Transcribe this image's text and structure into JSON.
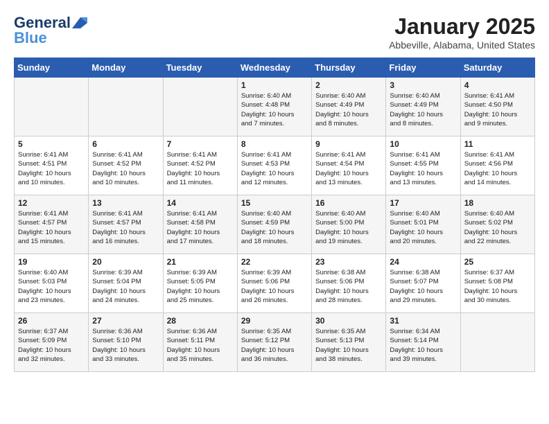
{
  "header": {
    "logo_line1": "General",
    "logo_line2": "Blue",
    "month": "January 2025",
    "location": "Abbeville, Alabama, United States"
  },
  "weekdays": [
    "Sunday",
    "Monday",
    "Tuesday",
    "Wednesday",
    "Thursday",
    "Friday",
    "Saturday"
  ],
  "weeks": [
    [
      {
        "day": "",
        "info": ""
      },
      {
        "day": "",
        "info": ""
      },
      {
        "day": "",
        "info": ""
      },
      {
        "day": "1",
        "info": "Sunrise: 6:40 AM\nSunset: 4:48 PM\nDaylight: 10 hours\nand 7 minutes."
      },
      {
        "day": "2",
        "info": "Sunrise: 6:40 AM\nSunset: 4:49 PM\nDaylight: 10 hours\nand 8 minutes."
      },
      {
        "day": "3",
        "info": "Sunrise: 6:40 AM\nSunset: 4:49 PM\nDaylight: 10 hours\nand 8 minutes."
      },
      {
        "day": "4",
        "info": "Sunrise: 6:41 AM\nSunset: 4:50 PM\nDaylight: 10 hours\nand 9 minutes."
      }
    ],
    [
      {
        "day": "5",
        "info": "Sunrise: 6:41 AM\nSunset: 4:51 PM\nDaylight: 10 hours\nand 10 minutes."
      },
      {
        "day": "6",
        "info": "Sunrise: 6:41 AM\nSunset: 4:52 PM\nDaylight: 10 hours\nand 10 minutes."
      },
      {
        "day": "7",
        "info": "Sunrise: 6:41 AM\nSunset: 4:52 PM\nDaylight: 10 hours\nand 11 minutes."
      },
      {
        "day": "8",
        "info": "Sunrise: 6:41 AM\nSunset: 4:53 PM\nDaylight: 10 hours\nand 12 minutes."
      },
      {
        "day": "9",
        "info": "Sunrise: 6:41 AM\nSunset: 4:54 PM\nDaylight: 10 hours\nand 13 minutes."
      },
      {
        "day": "10",
        "info": "Sunrise: 6:41 AM\nSunset: 4:55 PM\nDaylight: 10 hours\nand 13 minutes."
      },
      {
        "day": "11",
        "info": "Sunrise: 6:41 AM\nSunset: 4:56 PM\nDaylight: 10 hours\nand 14 minutes."
      }
    ],
    [
      {
        "day": "12",
        "info": "Sunrise: 6:41 AM\nSunset: 4:57 PM\nDaylight: 10 hours\nand 15 minutes."
      },
      {
        "day": "13",
        "info": "Sunrise: 6:41 AM\nSunset: 4:57 PM\nDaylight: 10 hours\nand 16 minutes."
      },
      {
        "day": "14",
        "info": "Sunrise: 6:41 AM\nSunset: 4:58 PM\nDaylight: 10 hours\nand 17 minutes."
      },
      {
        "day": "15",
        "info": "Sunrise: 6:40 AM\nSunset: 4:59 PM\nDaylight: 10 hours\nand 18 minutes."
      },
      {
        "day": "16",
        "info": "Sunrise: 6:40 AM\nSunset: 5:00 PM\nDaylight: 10 hours\nand 19 minutes."
      },
      {
        "day": "17",
        "info": "Sunrise: 6:40 AM\nSunset: 5:01 PM\nDaylight: 10 hours\nand 20 minutes."
      },
      {
        "day": "18",
        "info": "Sunrise: 6:40 AM\nSunset: 5:02 PM\nDaylight: 10 hours\nand 22 minutes."
      }
    ],
    [
      {
        "day": "19",
        "info": "Sunrise: 6:40 AM\nSunset: 5:03 PM\nDaylight: 10 hours\nand 23 minutes."
      },
      {
        "day": "20",
        "info": "Sunrise: 6:39 AM\nSunset: 5:04 PM\nDaylight: 10 hours\nand 24 minutes."
      },
      {
        "day": "21",
        "info": "Sunrise: 6:39 AM\nSunset: 5:05 PM\nDaylight: 10 hours\nand 25 minutes."
      },
      {
        "day": "22",
        "info": "Sunrise: 6:39 AM\nSunset: 5:06 PM\nDaylight: 10 hours\nand 26 minutes."
      },
      {
        "day": "23",
        "info": "Sunrise: 6:38 AM\nSunset: 5:06 PM\nDaylight: 10 hours\nand 28 minutes."
      },
      {
        "day": "24",
        "info": "Sunrise: 6:38 AM\nSunset: 5:07 PM\nDaylight: 10 hours\nand 29 minutes."
      },
      {
        "day": "25",
        "info": "Sunrise: 6:37 AM\nSunset: 5:08 PM\nDaylight: 10 hours\nand 30 minutes."
      }
    ],
    [
      {
        "day": "26",
        "info": "Sunrise: 6:37 AM\nSunset: 5:09 PM\nDaylight: 10 hours\nand 32 minutes."
      },
      {
        "day": "27",
        "info": "Sunrise: 6:36 AM\nSunset: 5:10 PM\nDaylight: 10 hours\nand 33 minutes."
      },
      {
        "day": "28",
        "info": "Sunrise: 6:36 AM\nSunset: 5:11 PM\nDaylight: 10 hours\nand 35 minutes."
      },
      {
        "day": "29",
        "info": "Sunrise: 6:35 AM\nSunset: 5:12 PM\nDaylight: 10 hours\nand 36 minutes."
      },
      {
        "day": "30",
        "info": "Sunrise: 6:35 AM\nSunset: 5:13 PM\nDaylight: 10 hours\nand 38 minutes."
      },
      {
        "day": "31",
        "info": "Sunrise: 6:34 AM\nSunset: 5:14 PM\nDaylight: 10 hours\nand 39 minutes."
      },
      {
        "day": "",
        "info": ""
      }
    ]
  ]
}
